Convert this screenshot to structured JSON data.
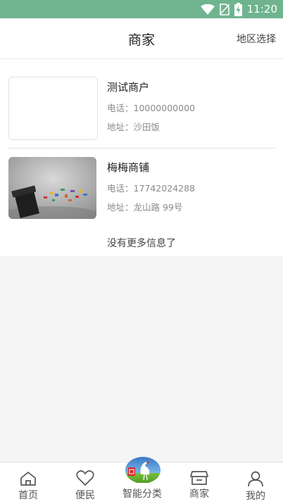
{
  "status_bar": {
    "time": "11:20",
    "icons": [
      "wifi-icon",
      "no-sim-icon",
      "battery-charging-icon"
    ],
    "bg_color": "#6fb48f"
  },
  "header": {
    "title": "商家",
    "action_label": "地区选择"
  },
  "merchants": [
    {
      "name": "测试商户",
      "phone": "电话：10000000000",
      "address": "地址：沙田饭",
      "image": "blank"
    },
    {
      "name": "梅梅商铺",
      "phone": "电话：17742024288",
      "address": "地址：龙山路 99号",
      "image": "trash-bin-photo"
    }
  ],
  "list_footer": "没有更多信息了",
  "tab_bar": {
    "items": [
      {
        "label": "首页",
        "icon": "home-icon"
      },
      {
        "label": "便民",
        "icon": "heart-icon"
      },
      {
        "label": "智能分类",
        "icon": "crane-logo-icon"
      },
      {
        "label": "商家",
        "icon": "store-icon"
      },
      {
        "label": "我的",
        "icon": "user-icon"
      }
    ]
  }
}
